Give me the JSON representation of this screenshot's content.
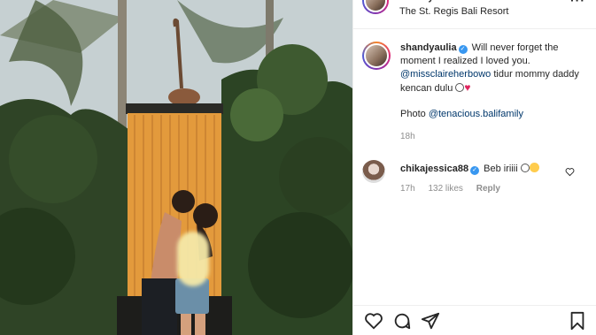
{
  "post": {
    "location": "The St. Regis Bali Resort",
    "author": "shandyaulia",
    "caption": {
      "username": "shandyaulia",
      "line1": "Will never forget the moment I realized I loved you.",
      "mention1": "@missclaireherbowo",
      "line2": "tidur mommy daddy kencan dulu",
      "photo_prefix": "Photo",
      "mention2": "@tenacious.balifamily",
      "time": "18h"
    },
    "comment": {
      "username": "chikajessica88",
      "text": "Beb iriiii",
      "time": "17h",
      "likes": "132 likes",
      "reply": "Reply"
    }
  },
  "icons": [
    "more-icon",
    "verified-icon",
    "heart-icon",
    "comment-icon",
    "share-icon",
    "bookmark-icon"
  ],
  "colors": {
    "link": "#00376b",
    "verified": "#3897f0",
    "meta": "#8e8e8e"
  }
}
